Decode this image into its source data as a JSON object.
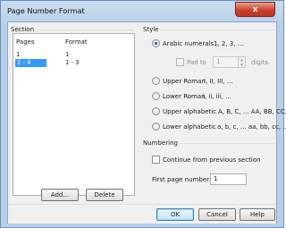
{
  "window": {
    "title": "Page Number Format",
    "close_glyph": "x"
  },
  "section": {
    "label": "Section",
    "columns": [
      "Pages",
      "Format"
    ],
    "rows": [
      {
        "pages": "1",
        "format": "1",
        "selected": false
      },
      {
        "pages": "2 - 4",
        "format": "1 - 3",
        "selected": true
      }
    ],
    "add_label": "Add...",
    "delete_label": "Delete"
  },
  "style": {
    "label": "Style",
    "options": [
      {
        "label": "Arabic numerals",
        "sample": "1, 2, 3, ...",
        "checked": true
      },
      {
        "label": "Upper Roman",
        "sample": "I, II, III, ...",
        "checked": false
      },
      {
        "label": "Lower Roman",
        "sample": "i, ii, iii, ...",
        "checked": false
      },
      {
        "label": "Upper alphabetic",
        "sample": "A, B, C, ... AA, BB, CC, ...",
        "checked": false
      },
      {
        "label": "Lower alphabetic",
        "sample": "a, b, c, ... aa, bb, cc, ...",
        "checked": false
      }
    ],
    "pad_label": "Pad to",
    "pad_value": "1",
    "pad_suffix": "digits."
  },
  "numbering": {
    "label": "Numbering",
    "continue_label": "Continue from previous section",
    "first_page_label": "First page number:",
    "first_page_value": "1"
  },
  "buttons": {
    "ok": "OK",
    "cancel": "Cancel",
    "help": "Help"
  },
  "colors": {
    "selection": "#3399ff",
    "close": "#c8432c",
    "title_bar": "#c9dcf0"
  }
}
